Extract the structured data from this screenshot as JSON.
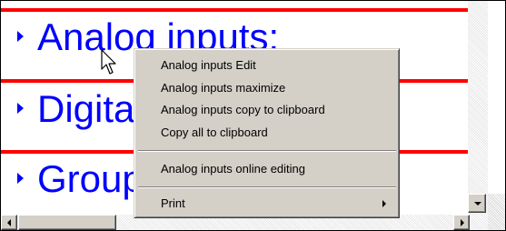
{
  "sections": [
    {
      "title": "Analog inputs:"
    },
    {
      "title": "Digital inputs:"
    },
    {
      "title": "Group information:"
    }
  ],
  "context_menu": {
    "items": [
      {
        "label": "Analog inputs Edit"
      },
      {
        "label": "Analog inputs maximize"
      },
      {
        "label": "Analog inputs copy to clipboard"
      },
      {
        "label": "Copy all to clipboard"
      },
      {
        "label": "Analog inputs online editing"
      },
      {
        "label": "Print",
        "has_submenu": true
      }
    ]
  },
  "colors": {
    "heading": "#0000ff",
    "separator_line": "#ff0000",
    "menu_bg": "#d4d0c8"
  },
  "icons": {
    "section_marker": "triangle-right-icon",
    "cursor": "arrow-pointer-icon"
  }
}
